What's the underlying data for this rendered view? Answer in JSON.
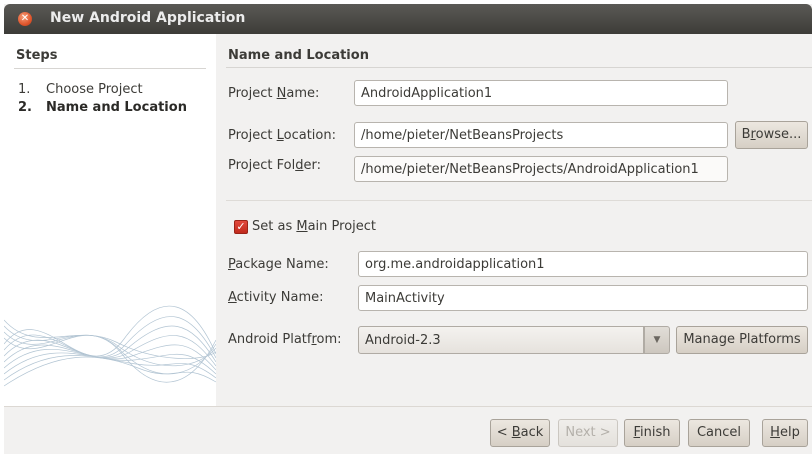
{
  "window": {
    "title": "New Android Application"
  },
  "steps": {
    "title": "Steps",
    "items": [
      {
        "num": "1.",
        "label": "Choose Project"
      },
      {
        "num": "2.",
        "label": "Name and Location"
      }
    ]
  },
  "panel": {
    "title": "Name and Location"
  },
  "fields": {
    "project_name": {
      "label_pre": "Project ",
      "label_mn": "N",
      "label_post": "ame:",
      "value": "AndroidApplication1"
    },
    "project_location": {
      "label_pre": "Project ",
      "label_mn": "L",
      "label_post": "ocation:",
      "value": "/home/pieter/NetBeansProjects"
    },
    "project_folder": {
      "label_pre": "Project Fol",
      "label_mn": "d",
      "label_post": "er:",
      "value": "/home/pieter/NetBeansProjects/AndroidApplication1"
    },
    "main_project": {
      "label_pre": "Set as ",
      "label_mn": "M",
      "label_post": "ain Project",
      "checked": true
    },
    "package_name": {
      "label_pre": "",
      "label_mn": "P",
      "label_post": "ackage Name:",
      "value": "org.me.androidapplication1"
    },
    "activity_name": {
      "label_pre": "",
      "label_mn": "A",
      "label_post": "ctivity Name:",
      "value": "MainActivity"
    },
    "android_platform": {
      "label_pre": "Android Platf",
      "label_mn": "r",
      "label_post": "om:",
      "value": "Android-2.3"
    }
  },
  "buttons": {
    "browse": {
      "pre": "B",
      "mn": "r",
      "post": "owse..."
    },
    "manage_platforms": "Manage Platforms",
    "back": {
      "pre": "< ",
      "mn": "B",
      "post": "ack"
    },
    "next": "Next >",
    "finish": {
      "pre": "",
      "mn": "F",
      "post": "inish"
    },
    "cancel": "Cancel",
    "help": {
      "pre": "",
      "mn": "H",
      "post": "elp"
    }
  },
  "colors": {
    "accent_check": "#d8382a",
    "titlebar": "#4a4945"
  },
  "icons": {
    "close": "close-icon",
    "check": "checkmark-icon",
    "dropdown": "chevron-down-icon"
  }
}
